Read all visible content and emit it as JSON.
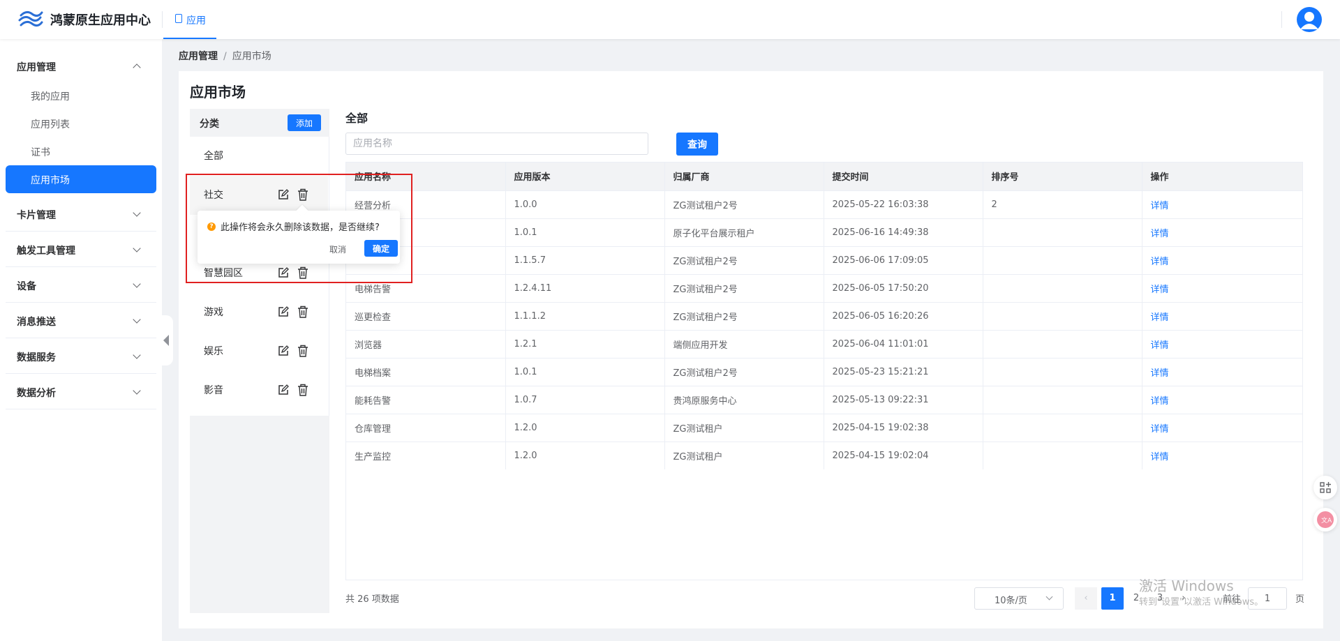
{
  "header": {
    "app_title": "鸿蒙原生应用中心",
    "tab_label": "应用"
  },
  "sidebar": {
    "groups": [
      {
        "label": "应用管理",
        "expanded": true,
        "items": [
          {
            "label": "我的应用",
            "active": false
          },
          {
            "label": "应用列表",
            "active": false
          },
          {
            "label": "证书",
            "active": false
          },
          {
            "label": "应用市场",
            "active": true
          }
        ]
      },
      {
        "label": "卡片管理",
        "expanded": false
      },
      {
        "label": "触发工具管理",
        "expanded": false
      },
      {
        "label": "设备",
        "expanded": false
      },
      {
        "label": "消息推送",
        "expanded": false
      },
      {
        "label": "数据服务",
        "expanded": false
      },
      {
        "label": "数据分析",
        "expanded": false
      }
    ]
  },
  "breadcrumb": [
    "应用管理",
    "/",
    "应用市场"
  ],
  "page_title": "应用市场",
  "category_panel": {
    "title": "分类",
    "add_label": "添加",
    "items": [
      "全部",
      "社交",
      "智慧园区",
      "游戏",
      "娱乐",
      "影音"
    ]
  },
  "content": {
    "section_title": "全部",
    "search_placeholder": "应用名称",
    "query_label": "查询"
  },
  "table": {
    "columns": [
      "应用名称",
      "应用版本",
      "归属厂商",
      "提交时间",
      "排序号",
      "操作"
    ],
    "rows": [
      [
        "经营分析",
        "1.0.0",
        "ZG测试租户2号",
        "2025-05-22 16:03:38",
        "2",
        "详情"
      ],
      [
        "",
        "1.0.1",
        "原子化平台展示租户",
        "2025-06-16 14:49:38",
        "",
        "详情"
      ],
      [
        "",
        "1.1.5.7",
        "ZG测试租户2号",
        "2025-06-06 17:09:05",
        "",
        "详情"
      ],
      [
        "电梯告警",
        "1.2.4.11",
        "ZG测试租户2号",
        "2025-06-05 17:50:20",
        "",
        "详情"
      ],
      [
        "巡更检查",
        "1.1.1.2",
        "ZG测试租户2号",
        "2025-06-05 16:20:26",
        "",
        "详情"
      ],
      [
        "浏览器",
        "1.2.1",
        "端侧应用开发",
        "2025-06-04 11:01:01",
        "",
        "详情"
      ],
      [
        "电梯档案",
        "1.0.1",
        "ZG测试租户2号",
        "2025-05-23 15:21:21",
        "",
        "详情"
      ],
      [
        "能耗告警",
        "1.0.7",
        "贵鸿原服务中心",
        "2025-05-13 09:22:31",
        "",
        "详情"
      ],
      [
        "仓库管理",
        "1.2.0",
        "ZG测试租户",
        "2025-04-15 19:02:38",
        "",
        "详情"
      ],
      [
        "生产监控",
        "1.2.0",
        "ZG测试租户",
        "2025-04-15 19:02:04",
        "",
        "详情"
      ]
    ]
  },
  "pagination": {
    "total_text": "共 26 项数据",
    "page_size": "10条/页",
    "pages": [
      "1",
      "2",
      "3"
    ],
    "current_page": 1,
    "goto_label": "前往",
    "goto_value": "1",
    "page_unit": "页"
  },
  "popconfirm": {
    "message": "此操作将会永久删除该数据，是否继续?",
    "cancel_label": "取消",
    "confirm_label": "确定"
  },
  "watermark": {
    "line1": "激活 Windows",
    "line2": "转到\"设置\"以激活 Windows。"
  },
  "colors": {
    "primary": "#1677ff",
    "warning": "#ff9900",
    "highlight": "#e02020"
  }
}
